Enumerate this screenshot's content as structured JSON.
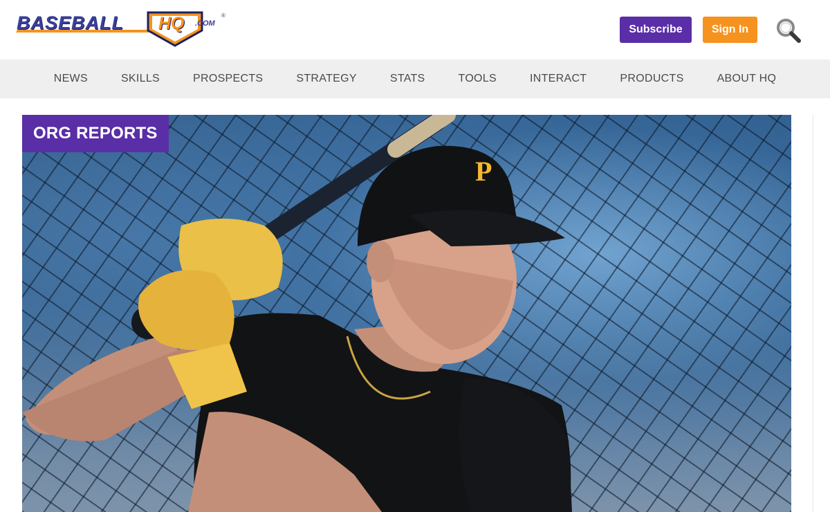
{
  "brand": {
    "name": "BASEBALL",
    "mark": "HQ",
    "domain": ".COM",
    "trademark": "®",
    "colors": {
      "navy": "#3b3f9a",
      "orange": "#f4931f"
    }
  },
  "header": {
    "subscribe_label": "Subscribe",
    "signin_label": "Sign In",
    "search_icon": "search-icon",
    "colors": {
      "subscribe": "#5a2ea6",
      "signin": "#f6921e"
    }
  },
  "nav": {
    "items": [
      {
        "label": "NEWS"
      },
      {
        "label": "SKILLS"
      },
      {
        "label": "PROSPECTS"
      },
      {
        "label": "STRATEGY"
      },
      {
        "label": "STATS"
      },
      {
        "label": "TOOLS"
      },
      {
        "label": "INTERACT"
      },
      {
        "label": "PRODUCTS"
      },
      {
        "label": "ABOUT HQ"
      }
    ]
  },
  "hero": {
    "category": "ORG REPORTS",
    "cap_logo": "P"
  }
}
